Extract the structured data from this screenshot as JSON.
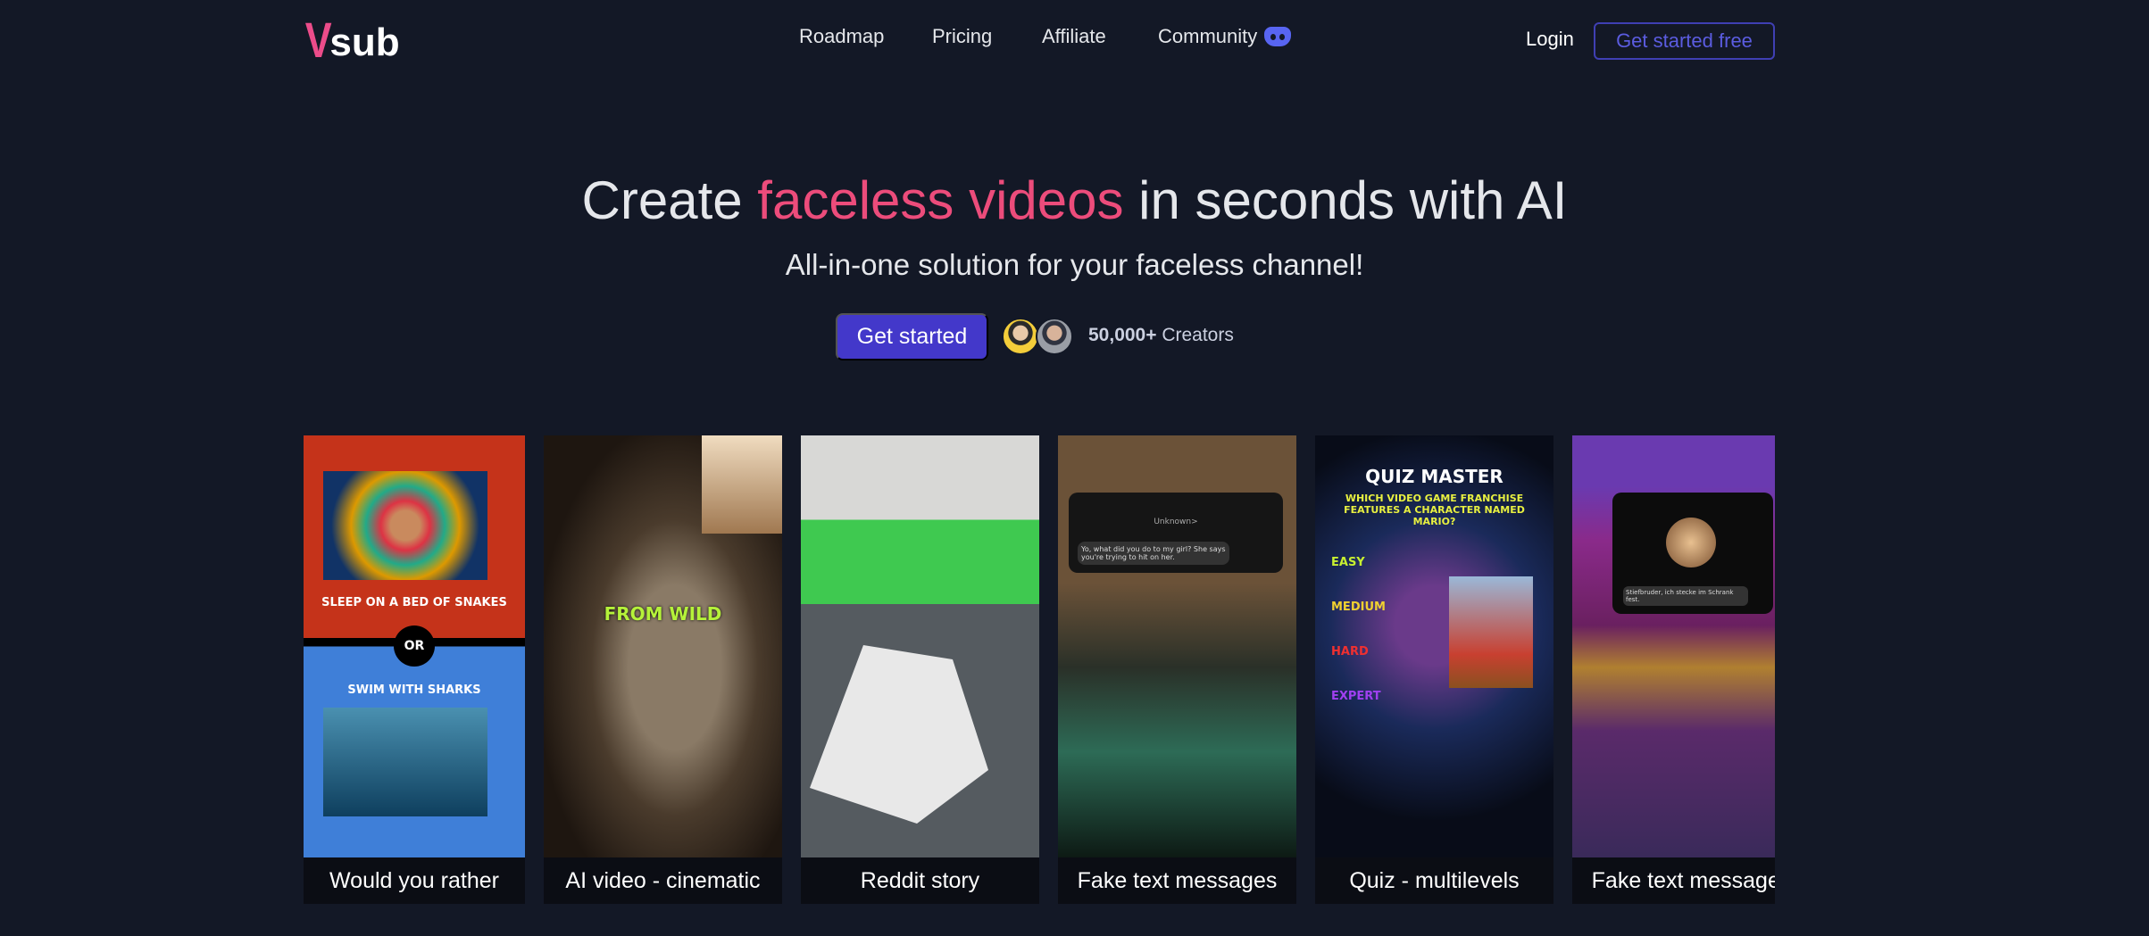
{
  "brand": {
    "logo_v": "V",
    "logo_rest": "sub",
    "accent": "#ec4c8a"
  },
  "nav": {
    "items": [
      "Roadmap",
      "Pricing",
      "Affiliate",
      "Community"
    ],
    "community_icon": "discord-icon",
    "login": "Login",
    "get_started_free": "Get started free"
  },
  "hero": {
    "title_pre": "Create ",
    "title_highlight": "faceless videos",
    "title_post": " in seconds with AI",
    "subtitle": "All-in-one solution for your faceless channel!",
    "cta": "Get started",
    "creators_count": "50,000+",
    "creators_label": " Creators"
  },
  "cards": [
    {
      "caption": "Would you rather",
      "overlay": [
        "SLEEP ON A BED OF SNAKES",
        "OR",
        "SWIM WITH SHARKS"
      ]
    },
    {
      "caption": "AI video - cinematic",
      "overlay": [
        "FROM WILD"
      ]
    },
    {
      "caption": "Reddit story",
      "overlay": []
    },
    {
      "caption": "Fake text messages",
      "overlay": [
        "Unknown>",
        "Yo, what did you do to my girl? She says you're trying to hit on her."
      ]
    },
    {
      "caption": "Quiz - multilevels",
      "overlay": [
        "QUIZ MASTER",
        "WHICH VIDEO GAME FRANCHISE FEATURES A CHARACTER NAMED MARIO?",
        "EASY",
        "MEDIUM",
        "HARD",
        "EXPERT"
      ]
    },
    {
      "caption": "Fake text messages",
      "overlay": [
        "Stiefbruder, ich stecke im Schrank fest."
      ]
    }
  ]
}
